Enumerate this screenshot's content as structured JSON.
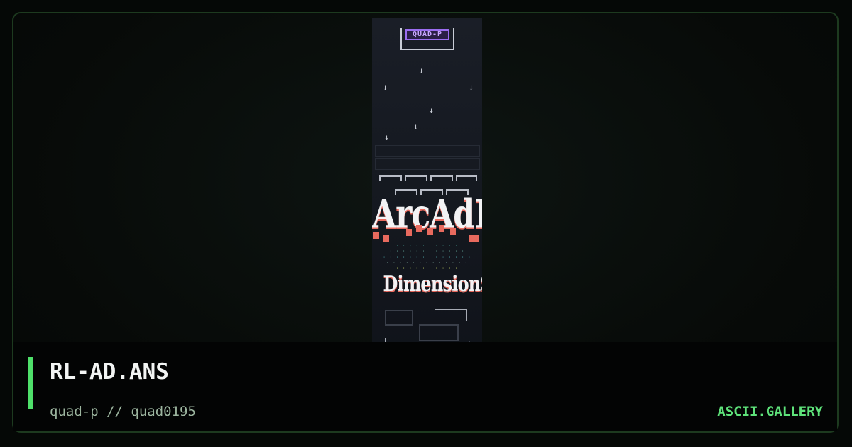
{
  "artwork": {
    "badge_text": "QUAD-P",
    "word_top": "ArcAdE",
    "word_bottom": "DimensionS"
  },
  "footer": {
    "title": "RL-AD.ANS",
    "subtitle": "quad-p // quad0195",
    "brand": "ASCII.GALLERY"
  },
  "colors": {
    "accent": "#4ee06a",
    "brand": "#5ee27a",
    "badge": "#9b6df0",
    "drip": "#e86a5e"
  }
}
